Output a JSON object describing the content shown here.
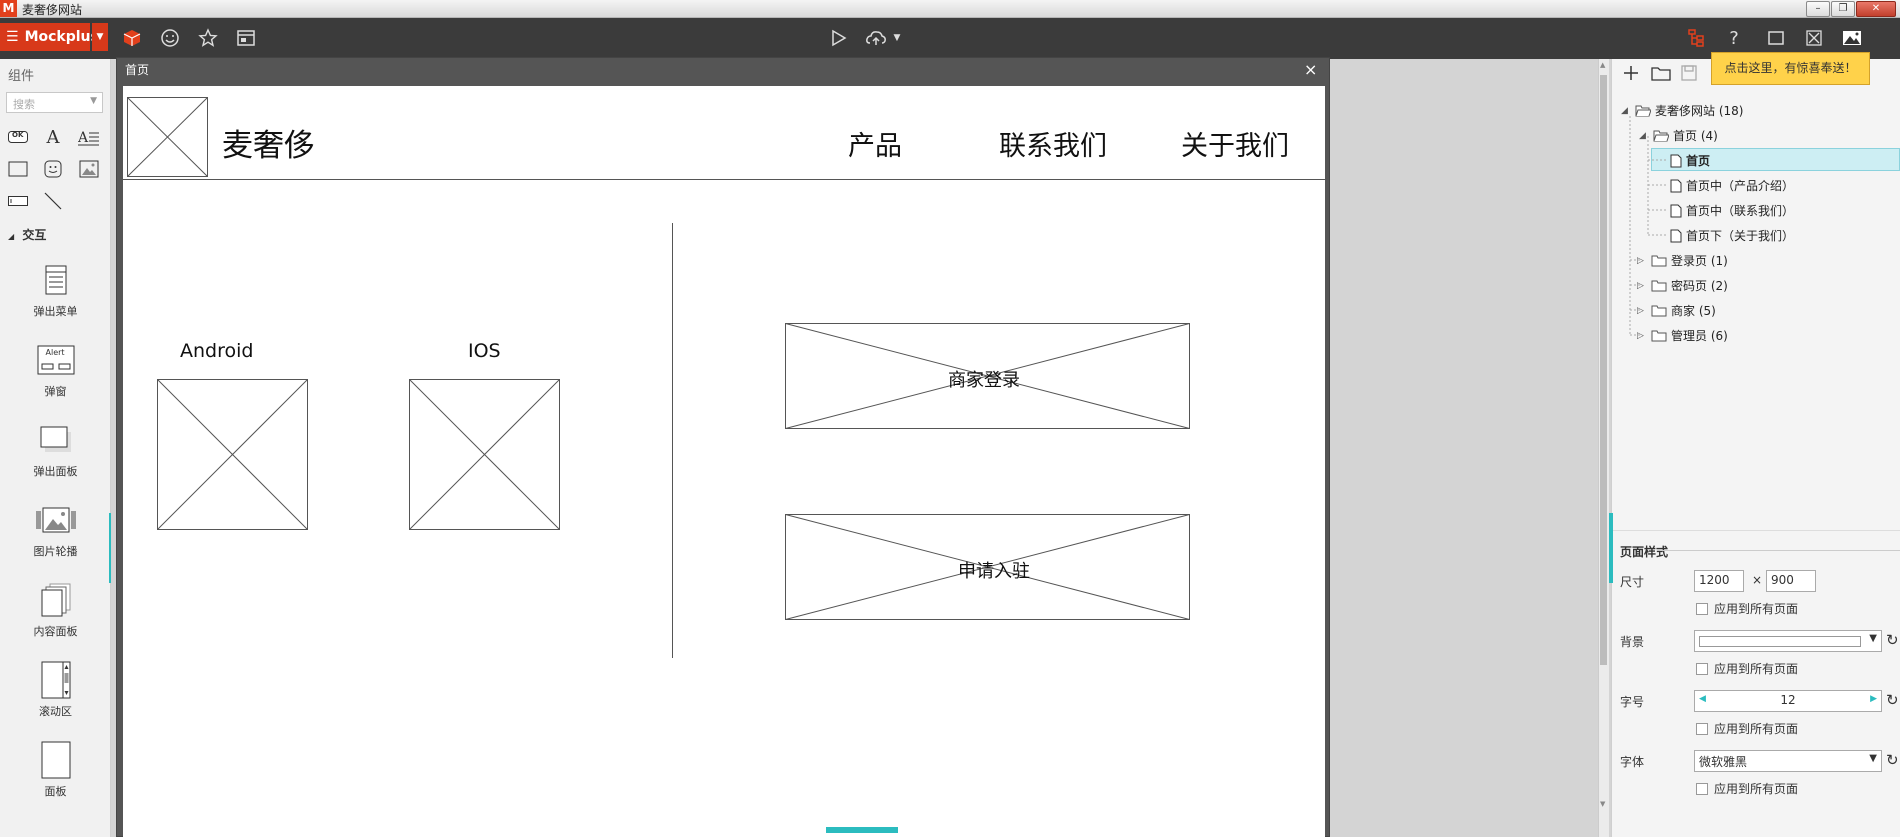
{
  "window": {
    "title": "麦奢侈网站",
    "logo": "M"
  },
  "toolbar": {
    "brand": "Mockplus"
  },
  "left_panel": {
    "title": "组件",
    "search_placeholder": "搜索",
    "ok_label": "OK",
    "section_title": "交互",
    "items": [
      "弹出菜单",
      "弹窗",
      "弹出面板",
      "图片轮播",
      "内容面板",
      "滚动区",
      "面板"
    ],
    "alert_label": "Alert"
  },
  "page_window": {
    "title": "首页",
    "close": "×"
  },
  "page": {
    "logo_text": "麦奢侈",
    "nav": [
      "产品",
      "联系我们",
      "关于我们"
    ],
    "platforms": [
      "Android",
      "IOS"
    ],
    "buttons": [
      "商家登录",
      "申请入驻"
    ]
  },
  "tip": "点击这里，有惊喜奉送！",
  "tree": [
    {
      "label": "麦奢侈网站 (18)",
      "level": 0,
      "kind": "folder-open",
      "expanded": true
    },
    {
      "label": "首页 (4)",
      "level": 1,
      "kind": "folder-open",
      "expanded": true
    },
    {
      "label": "首页",
      "level": 2,
      "kind": "page",
      "selected": true
    },
    {
      "label": "首页中（产品介绍）",
      "level": 2,
      "kind": "page"
    },
    {
      "label": "首页中（联系我们）",
      "level": 2,
      "kind": "page"
    },
    {
      "label": "首页下（关于我们）",
      "level": 2,
      "kind": "page"
    },
    {
      "label": "登录页 (1)",
      "level": 1,
      "kind": "folder",
      "expanded": false
    },
    {
      "label": "密码页 (2)",
      "level": 1,
      "kind": "folder",
      "expanded": false
    },
    {
      "label": "商家 (5)",
      "level": 1,
      "kind": "folder",
      "expanded": false
    },
    {
      "label": "管理员 (6)",
      "level": 1,
      "kind": "folder",
      "expanded": false
    }
  ],
  "props": {
    "title": "页面样式",
    "size_label": "尺寸",
    "width": "1200",
    "times": "×",
    "height": "900",
    "apply_all": "应用到所有页面",
    "bg_label": "背景",
    "font_size_label": "字号",
    "font_size": "12",
    "font_label": "字体",
    "font": "微软雅黑"
  },
  "colors": {
    "brand": "#d8391a",
    "accent": "#2bbcbf",
    "tip": "#ffd24a",
    "toolbar": "#3b3b3b"
  }
}
